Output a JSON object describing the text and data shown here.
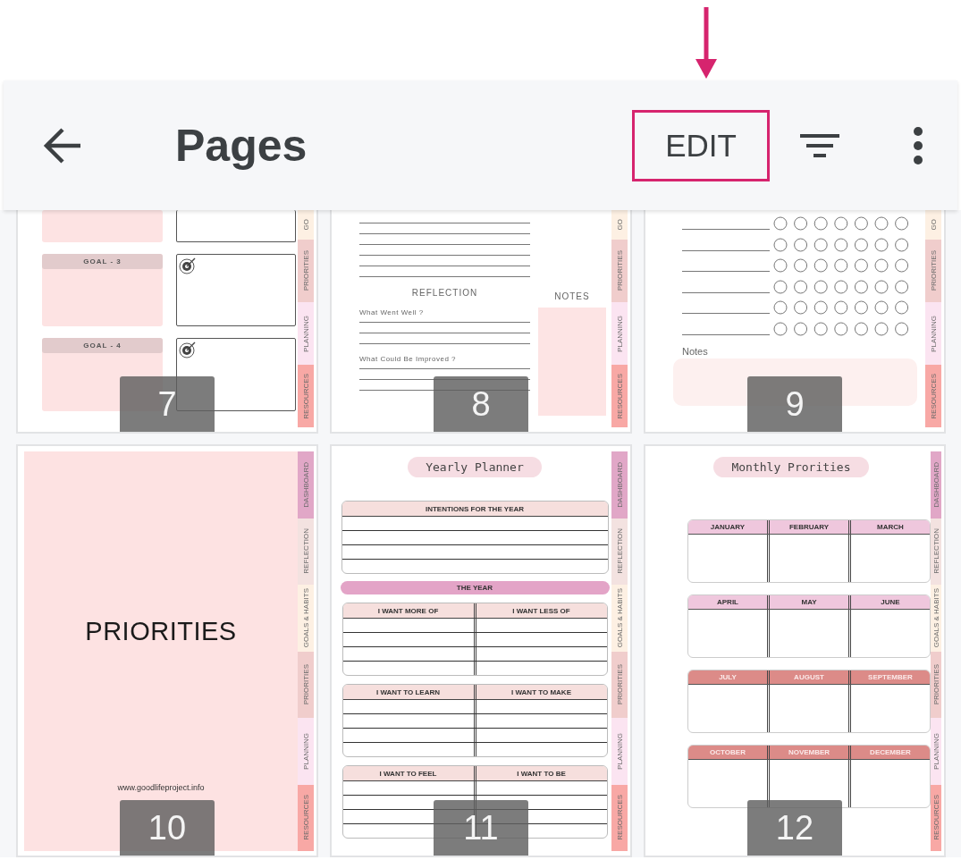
{
  "app_bar": {
    "title": "Pages",
    "edit_button": {
      "label": "EDIT",
      "highlighted": true
    }
  },
  "rows": [
    {
      "pages": [
        {
          "number": "7",
          "kind": "goals",
          "goal_labels": [
            "GOAL - 3",
            "GOAL - 4"
          ],
          "tabs": [
            {
              "label": "GO",
              "color": "#fdf0e3"
            },
            {
              "label": "PRIORITIES",
              "color": "#f0cdcc"
            },
            {
              "label": "PLANNING",
              "color": "#fbe4f1"
            },
            {
              "label": "RESOURCES",
              "color": "#f8a8a5"
            }
          ]
        },
        {
          "number": "8",
          "kind": "reflection",
          "heading": "REFLECTION",
          "prompts": [
            "What Went Well ?",
            "What Could Be Improved ?"
          ],
          "notes_label": "NOTES",
          "tabs": [
            {
              "label": "GO",
              "color": "#fdf0e3"
            },
            {
              "label": "PRIORITIES",
              "color": "#f0cdcc"
            },
            {
              "label": "PLANNING",
              "color": "#fbe4f1"
            },
            {
              "label": "RESOURCES",
              "color": "#f8a8a5"
            }
          ]
        },
        {
          "number": "9",
          "kind": "tracker",
          "notes_label": "Notes",
          "tabs": [
            {
              "label": "GO",
              "color": "#fdf0e3"
            },
            {
              "label": "PRIORITIES",
              "color": "#f0cdcc"
            },
            {
              "label": "PLANNING",
              "color": "#fbe4f1"
            },
            {
              "label": "RESOURCES",
              "color": "#f8a8a5"
            }
          ]
        }
      ]
    },
    {
      "pages": [
        {
          "number": "10",
          "kind": "cover",
          "heading": "PRIORITIES",
          "url": "www.goodlifeproject.info",
          "tabs": [
            {
              "label": "DASHBOARD",
              "color": "#e1a7c7"
            },
            {
              "label": "REFLECTION",
              "color": "#f3e2e0"
            },
            {
              "label": "GOALS & HABITS",
              "color": "#fdf0e3"
            },
            {
              "label": "PRIORITIES",
              "color": "#f0cdcc"
            },
            {
              "label": "PLANNING",
              "color": "#fbe4f1"
            },
            {
              "label": "RESOURCES",
              "color": "#f8a8a5"
            }
          ]
        },
        {
          "number": "11",
          "kind": "yearly",
          "title": "Yearly Planner",
          "intentions": "INTENTIONS FOR THE YEAR",
          "band": "THE YEAR",
          "pairs": [
            [
              "I WANT MORE OF",
              "I WANT LESS OF"
            ],
            [
              "I WANT TO LEARN",
              "I WANT TO MAKE"
            ],
            [
              "I WANT TO FEEL",
              "I WANT TO BE"
            ]
          ],
          "tabs": [
            {
              "label": "DASHBOARD",
              "color": "#e1a7c7"
            },
            {
              "label": "REFLECTION",
              "color": "#f3e2e0"
            },
            {
              "label": "GOALS & HABITS",
              "color": "#fdf0e3"
            },
            {
              "label": "PRIORITIES",
              "color": "#f0cdcc"
            },
            {
              "label": "PLANNING",
              "color": "#fbe4f1"
            },
            {
              "label": "RESOURCES",
              "color": "#f8a8a5"
            }
          ]
        },
        {
          "number": "12",
          "kind": "monthly",
          "title": "Monthly Prorities",
          "quarters": [
            {
              "months": [
                "JANUARY",
                "FEBRUARY",
                "MARCH"
              ],
              "color": "#efc7dd"
            },
            {
              "months": [
                "APRIL",
                "MAY",
                "JUNE"
              ],
              "color": "#efc7dd"
            },
            {
              "months": [
                "JULY",
                "AUGUST",
                "SEPTEMBER"
              ],
              "color": "#dc8b88"
            },
            {
              "months": [
                "OCTOBER",
                "NOVEMBER",
                "DECEMBER"
              ],
              "color": "#dc8b88"
            }
          ],
          "tabs": [
            {
              "label": "DASHBOARD",
              "color": "#e1a7c7"
            },
            {
              "label": "REFLECTION",
              "color": "#f3e2e0"
            },
            {
              "label": "GOALS & HABITS",
              "color": "#fdf0e3"
            },
            {
              "label": "PRIORITIES",
              "color": "#f0cdcc"
            },
            {
              "label": "PLANNING",
              "color": "#fbe4f1"
            },
            {
              "label": "RESOURCES",
              "color": "#f8a8a5"
            }
          ]
        }
      ]
    }
  ]
}
